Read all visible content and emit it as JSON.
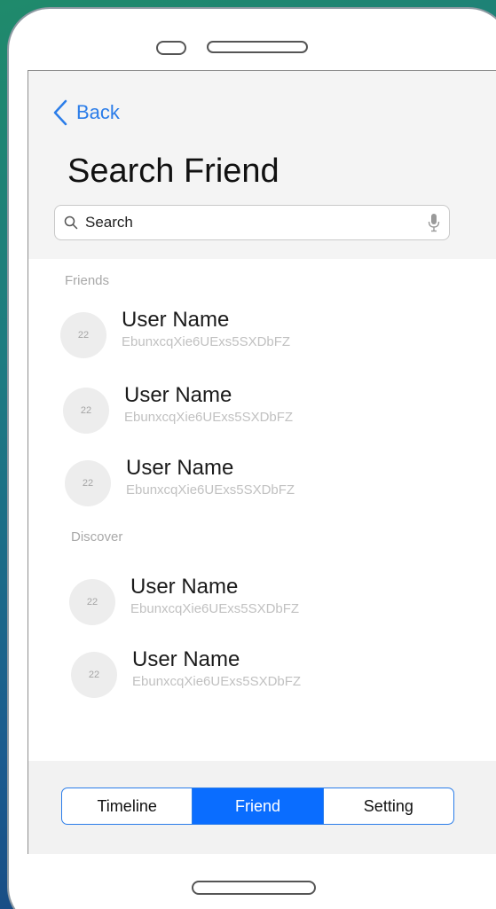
{
  "nav": {
    "back_label": "Back"
  },
  "header": {
    "title": "Search Friend"
  },
  "search": {
    "placeholder": "Search"
  },
  "sections": {
    "friends_label": "Friends",
    "discover_label": "Discover"
  },
  "friends": [
    {
      "avatar_text": "22",
      "name": "User Name",
      "id": "EbunxcqXie6UExs5SXDbFZ"
    },
    {
      "avatar_text": "22",
      "name": "User Name",
      "id": "EbunxcqXie6UExs5SXDbFZ"
    },
    {
      "avatar_text": "22",
      "name": "User Name",
      "id": "EbunxcqXie6UExs5SXDbFZ"
    }
  ],
  "discover": [
    {
      "avatar_text": "22",
      "name": "User Name",
      "id": "EbunxcqXie6UExs5SXDbFZ"
    },
    {
      "avatar_text": "22",
      "name": "User Name",
      "id": "EbunxcqXie6UExs5SXDbFZ"
    }
  ],
  "tabs": [
    {
      "label": "Timeline",
      "active": false
    },
    {
      "label": "Friend",
      "active": true
    },
    {
      "label": "Setting",
      "active": false
    }
  ],
  "colors": {
    "accent": "#2b7de9",
    "active_tab": "#0a6dff"
  },
  "icons": {
    "back": "chevron-left-icon",
    "search": "search-icon",
    "voice": "microphone-icon"
  }
}
